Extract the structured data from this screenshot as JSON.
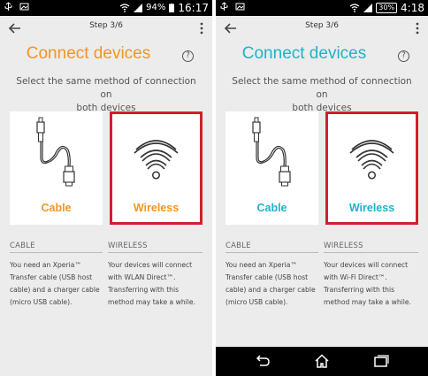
{
  "colors": {
    "orange": "#f39521",
    "teal": "#1fb3c8",
    "highlight_border": "#d21f2c"
  },
  "left": {
    "status": {
      "battery": "94%",
      "time": "16:17"
    },
    "step": "Step 3/6",
    "title": "Connect devices",
    "help": "?",
    "subtitle_line1": "Select the same method of connection on",
    "subtitle_line2": "both devices",
    "cable_label": "Cable",
    "wireless_label": "Wireless",
    "cable_head": "CABLE",
    "wireless_head": "WIRELESS",
    "cable_text": [
      "You need an Xperia™",
      "Transfer cable (USB host",
      "cable) and a charger cable",
      "(micro USB cable)."
    ],
    "wireless_text": [
      "Your devices will connect",
      "with WLAN Direct™.",
      "Transferring with this",
      "method may take a while."
    ]
  },
  "right": {
    "status": {
      "battery": "30%",
      "time": "4:18"
    },
    "step": "Step 3/6",
    "title": "Connect devices",
    "help": "?",
    "subtitle_line1": "Select the same method of connection on",
    "subtitle_line2": "both devices",
    "cable_label": "Cable",
    "wireless_label": "Wireless",
    "cable_head": "CABLE",
    "wireless_head": "WIRELESS",
    "cable_text": [
      "You need an Xperia™",
      "Transfer cable (USB host",
      "cable) and a charger cable",
      "(micro USB cable)."
    ],
    "wireless_text": [
      "Your devices will connect",
      "with Wi-Fi Direct™.",
      "Transferring with this",
      "method may take a while."
    ]
  },
  "icons": {
    "back": "arrow-left-icon",
    "overflow": "more-vertical-icon",
    "cable": "usb-cable-icon",
    "wireless": "wifi-icon",
    "nav_back": "nav-back-icon",
    "nav_home": "nav-home-icon",
    "nav_recents": "nav-recents-icon"
  }
}
